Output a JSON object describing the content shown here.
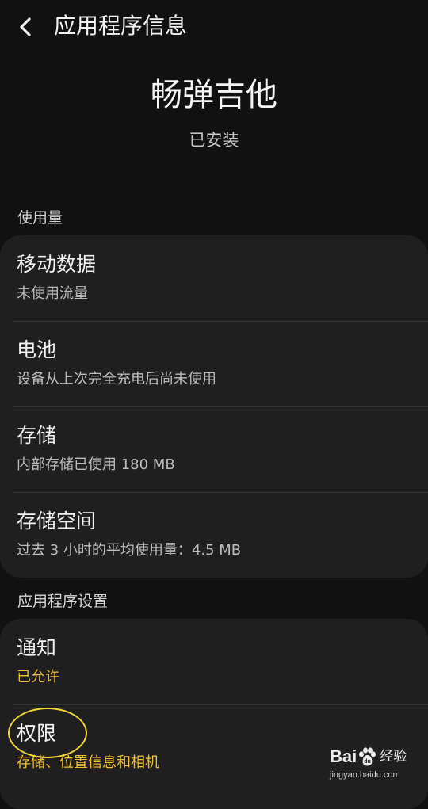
{
  "header": {
    "title": "应用程序信息",
    "back_icon": "chevron-left-icon"
  },
  "app": {
    "name": "畅弹吉他",
    "status": "已安装"
  },
  "usage_section": {
    "title": "使用量",
    "items": [
      {
        "title": "移动数据",
        "subtitle": "未使用流量"
      },
      {
        "title": "电池",
        "subtitle": "设备从上次完全充电后尚未使用"
      },
      {
        "title": "存储",
        "subtitle": "内部存储已使用 180 MB"
      },
      {
        "title": "存储空间",
        "subtitle": "过去 3 小时的平均使用量：4.5 MB"
      }
    ]
  },
  "settings_section": {
    "title": "应用程序设置",
    "items": [
      {
        "title": "通知",
        "subtitle": "已允许"
      },
      {
        "title": "权限",
        "subtitle": "存储、位置信息和相机"
      }
    ]
  },
  "watermark": {
    "brand_left": "Bai",
    "brand_right": "经验",
    "url": "jingyan.baidu.com"
  },
  "colors": {
    "background": "#111111",
    "card": "#1f1f1f",
    "accent": "#f2c12e",
    "annotation": "#f3d73a"
  }
}
